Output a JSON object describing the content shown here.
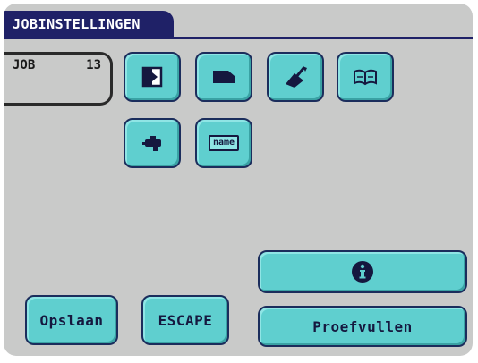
{
  "header": {
    "title": "JOBINSTELLINGEN"
  },
  "job": {
    "label": "JOB",
    "number": "13"
  },
  "icons": {
    "name_label": "name"
  },
  "buttons": {
    "save": "Opslaan",
    "escape": "ESCAPE",
    "test_fill": "Proefvullen"
  },
  "colors": {
    "title_bar": "#1f2167",
    "screen_bg": "#c9cac9",
    "button_fill": "#5fcfcf",
    "button_border": "#1b2d5c"
  }
}
